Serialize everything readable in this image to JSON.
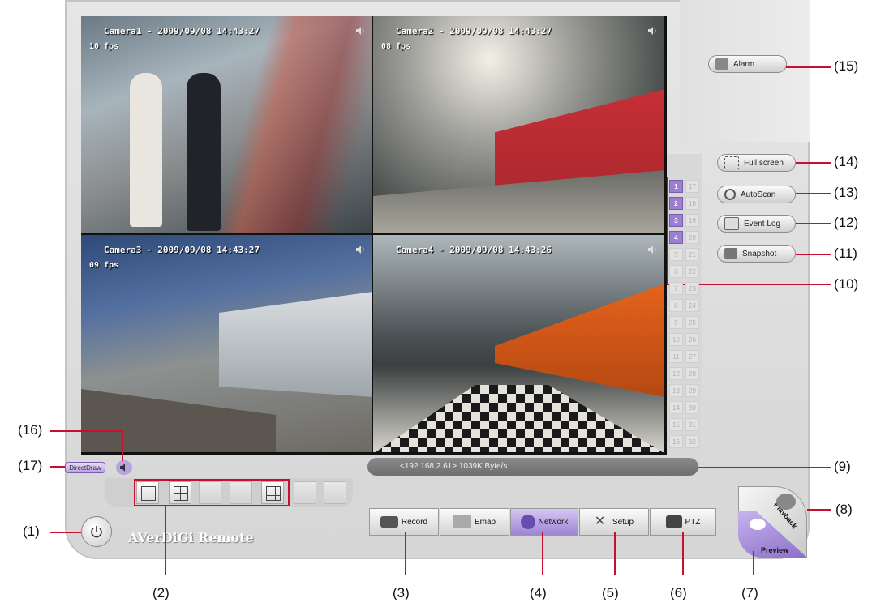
{
  "window": {
    "brand": "AVerDiGi Remote",
    "render_mode": "DirectDraw",
    "status_text": "<192.168.2.61> 1039K Byte/s"
  },
  "cameras": [
    {
      "label": "Camera1 - 2009/09/08 14:43:27",
      "fps": "10 fps"
    },
    {
      "label": "Camera2 - 2009/09/08 14:43:27",
      "fps": "08 fps"
    },
    {
      "label": "Camera3 - 2009/09/08 14:43:27",
      "fps": "09 fps"
    },
    {
      "label": "Camera4 - 2009/09/08 14:43:26",
      "fps": ""
    }
  ],
  "camera_grid": {
    "left": [
      "1",
      "2",
      "3",
      "4",
      "5",
      "6",
      "7",
      "8",
      "9",
      "10",
      "11",
      "12",
      "13",
      "14",
      "15",
      "16"
    ],
    "right": [
      "17",
      "18",
      "19",
      "20",
      "21",
      "22",
      "23",
      "24",
      "25",
      "26",
      "27",
      "28",
      "29",
      "30",
      "31",
      "32"
    ],
    "active": [
      "1",
      "2",
      "3",
      "4"
    ]
  },
  "side_buttons": {
    "alarm": "Alarm",
    "full_screen": "Full screen",
    "autoscan": "AutoScan",
    "event_log": "Event Log",
    "snapshot": "Snapshot"
  },
  "bottom_buttons": {
    "record": "Record",
    "emap": "Emap",
    "network": "Network",
    "setup": "Setup",
    "ptz": "PTZ"
  },
  "mode_buttons": {
    "playback": "Playback",
    "preview": "Preview"
  },
  "callouts": {
    "c1": "(1)",
    "c2": "(2)",
    "c3": "(3)",
    "c4": "(4)",
    "c5": "(5)",
    "c6": "(6)",
    "c7": "(7)",
    "c8": "(8)",
    "c9": "(9)",
    "c10": "(10)",
    "c11": "(11)",
    "c12": "(12)",
    "c13": "(13)",
    "c14": "(14)",
    "c15": "(15)",
    "c16": "(16)",
    "c17": "(17)"
  },
  "colors": {
    "accent_purple": "#9c7fce",
    "callout_red": "#c8102e",
    "train_red": "#c62f36",
    "train_orange": "#e5631c"
  },
  "icons": [
    "power-icon",
    "speaker-icon",
    "camera-icon",
    "alarm-icon",
    "fullscreen-icon",
    "autoscan-icon",
    "event-log-icon",
    "snapshot-icon",
    "record-icon",
    "emap-icon",
    "network-icon",
    "setup-icon",
    "ptz-icon",
    "playback-icon",
    "preview-icon"
  ]
}
